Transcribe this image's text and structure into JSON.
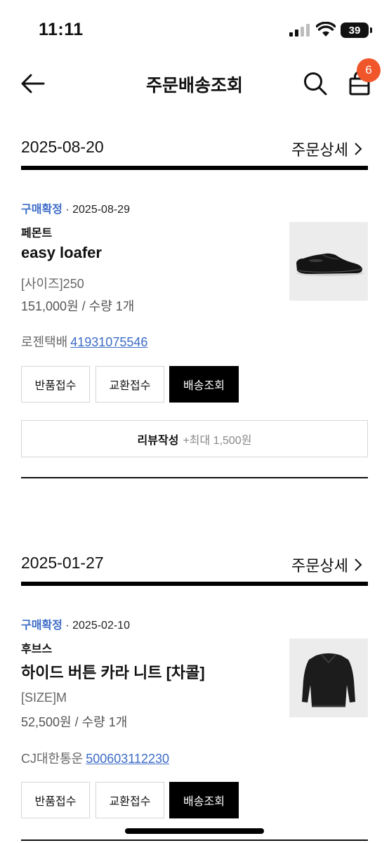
{
  "status_bar": {
    "time": "11:11",
    "battery": "39"
  },
  "header": {
    "title": "주문배송조회",
    "cart_count": "6"
  },
  "orders": [
    {
      "date": "2025-08-20",
      "detail_label": "주문상세",
      "status": "구매확정",
      "status_date": "· 2025-08-29",
      "brand": "페몬트",
      "product": "easy loafer",
      "option": "[사이즈]250",
      "price_qty": "151,000원 / 수량 1개",
      "courier": "로젠택배",
      "tracking": "41931075546",
      "buttons": [
        "반품접수",
        "교환접수",
        "배송조회"
      ],
      "review_label": "리뷰작성",
      "review_reward": "+최대 1,500원"
    },
    {
      "date": "2025-01-27",
      "detail_label": "주문상세",
      "status": "구매확정",
      "status_date": "· 2025-02-10",
      "brand": "후브스",
      "product": "하이드 버튼 카라 니트 [차콜]",
      "option": "[SIZE]M",
      "price_qty": "52,500원 / 수량 1개",
      "courier": "CJ대한통운",
      "tracking": "500603112230",
      "buttons": [
        "반품접수",
        "교환접수",
        "배송조회"
      ]
    }
  ],
  "icons": [
    "back-arrow-icon",
    "search-icon",
    "shopping-bag-icon",
    "chevron-right-icon"
  ],
  "colors": {
    "accent": "#3d6cc7",
    "badge": "#f0562a"
  }
}
